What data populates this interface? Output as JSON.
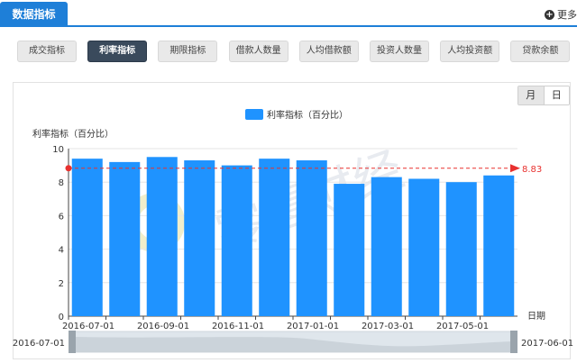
{
  "header": {
    "tab_label": "数据指标",
    "more_label": "更多"
  },
  "tabs": [
    {
      "label": "成交指标",
      "active": false
    },
    {
      "label": "利率指标",
      "active": true
    },
    {
      "label": "期限指标",
      "active": false
    },
    {
      "label": "借款人数量",
      "active": false
    },
    {
      "label": "人均借款额",
      "active": false
    },
    {
      "label": "投资人数量",
      "active": false
    },
    {
      "label": "人均投资额",
      "active": false
    },
    {
      "label": "贷款余额",
      "active": false
    }
  ],
  "period_toggle": {
    "month": "月",
    "day": "日",
    "selected": "月"
  },
  "watermark": "零壹财经",
  "chart_data": {
    "type": "bar",
    "categories": [
      "2016-07-01",
      "2016-08-01",
      "2016-09-01",
      "2016-10-01",
      "2016-11-01",
      "2016-12-01",
      "2017-01-01",
      "2017-02-01",
      "2017-03-01",
      "2017-04-01",
      "2017-05-01",
      "2017-06-01"
    ],
    "series": [
      {
        "name": "利率指标（百分比）",
        "values": [
          9.4,
          9.2,
          9.5,
          9.3,
          9.0,
          9.4,
          9.3,
          7.9,
          8.3,
          8.2,
          8.0,
          8.4
        ],
        "color": "#1f93ff"
      }
    ],
    "x_tick_labels": [
      "2016-07-01",
      "2016-09-01",
      "2016-11-01",
      "2017-01-01",
      "2017-03-01",
      "2017-05-01"
    ],
    "xlabel": "日期",
    "ylabel": "利率指标（百分比）",
    "ylim": [
      0,
      10
    ],
    "yticks": [
      0,
      2,
      4,
      6,
      8,
      10
    ],
    "grid": true,
    "legend": "top-center",
    "average_line": {
      "value": 8.83,
      "label": "8.83",
      "color": "#e8312f"
    },
    "range_slider": {
      "start_label": "2016-07-01",
      "end_label": "2017-06-01"
    }
  }
}
